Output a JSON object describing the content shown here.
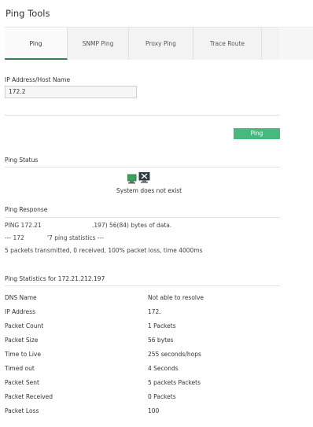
{
  "page_title": "Ping Tools",
  "tabs": [
    {
      "label": "Ping"
    },
    {
      "label": "SNMP Ping"
    },
    {
      "label": "Proxy Ping"
    },
    {
      "label": "Trace Route"
    }
  ],
  "form": {
    "ip_label": "IP Address/Host Name",
    "ip_value": "172.2",
    "ping_button": "Ping"
  },
  "status": {
    "section_title": "Ping Status",
    "icon": "monitor-error-icon",
    "message": "System does not exist"
  },
  "response": {
    "section_title": "Ping Response",
    "line1_a": "PING 172.21",
    "line1_b": ".197) 56(84) bytes of data.",
    "line2_a": "--- 172",
    "line2_b": "'7 ping statistics ---",
    "line3": "5 packets transmitted, 0 received, 100% packet loss, time 4000ms"
  },
  "statistics": {
    "section_title": "Ping Statistics for 172.21.212.197",
    "rows": [
      {
        "label": "DNS Name",
        "value": "Not able to resolve"
      },
      {
        "label": "IP Address",
        "value": "172."
      },
      {
        "label": "Packet Count",
        "value": "1 Packets"
      },
      {
        "label": "Packet Size",
        "value": "56 bytes"
      },
      {
        "label": "Time to Live",
        "value": "255 seconds/hops"
      },
      {
        "label": "Timed out",
        "value": "4 Seconds"
      },
      {
        "label": "Packet Sent",
        "value": "5 packets Packets"
      },
      {
        "label": "Packet Received",
        "value": "0 Packets"
      },
      {
        "label": "Packet Loss",
        "value": "100"
      }
    ]
  },
  "colors": {
    "accent": "#48b97e",
    "tab_active_border": "#3e7d57"
  }
}
